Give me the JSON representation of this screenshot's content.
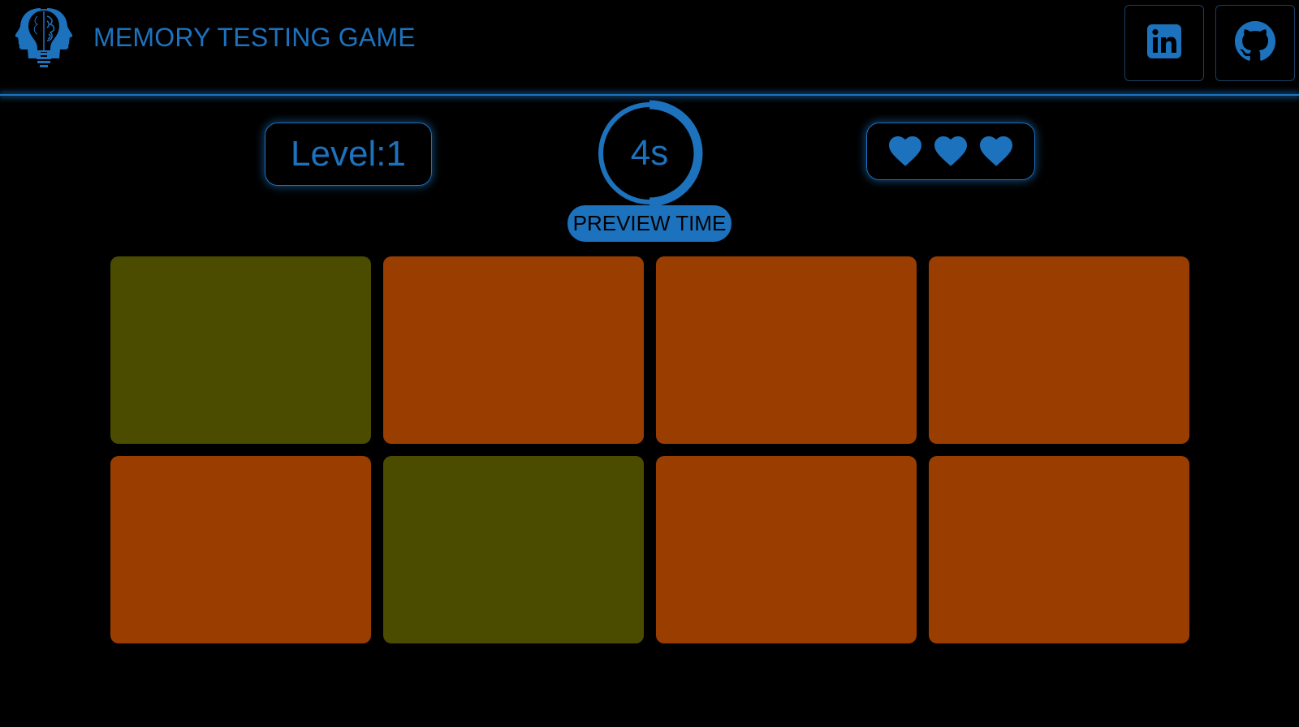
{
  "header": {
    "title": "MEMORY TESTING GAME",
    "logo_icon": "brain-head-logo-icon",
    "social": [
      {
        "name": "LinkedIn",
        "icon": "linkedin-icon"
      },
      {
        "name": "GitHub",
        "icon": "github-icon"
      }
    ]
  },
  "status": {
    "level_text": "Level:1",
    "timer_text": "4s",
    "timer_remaining_fraction": 0.5,
    "phase_label": "PREVIEW TIME",
    "lives": 3
  },
  "tiles": [
    {
      "color": "#4b4c00"
    },
    {
      "color": "#9a3d00"
    },
    {
      "color": "#9a3d00"
    },
    {
      "color": "#9a3d00"
    },
    {
      "color": "#9a3d00"
    },
    {
      "color": "#4b4c00"
    },
    {
      "color": "#9a3d00"
    },
    {
      "color": "#9a3d00"
    }
  ],
  "colors": {
    "accent": "#1d72bd",
    "background": "#000000",
    "tile_highlight": "#4b4c00",
    "tile_default": "#9a3d00"
  }
}
